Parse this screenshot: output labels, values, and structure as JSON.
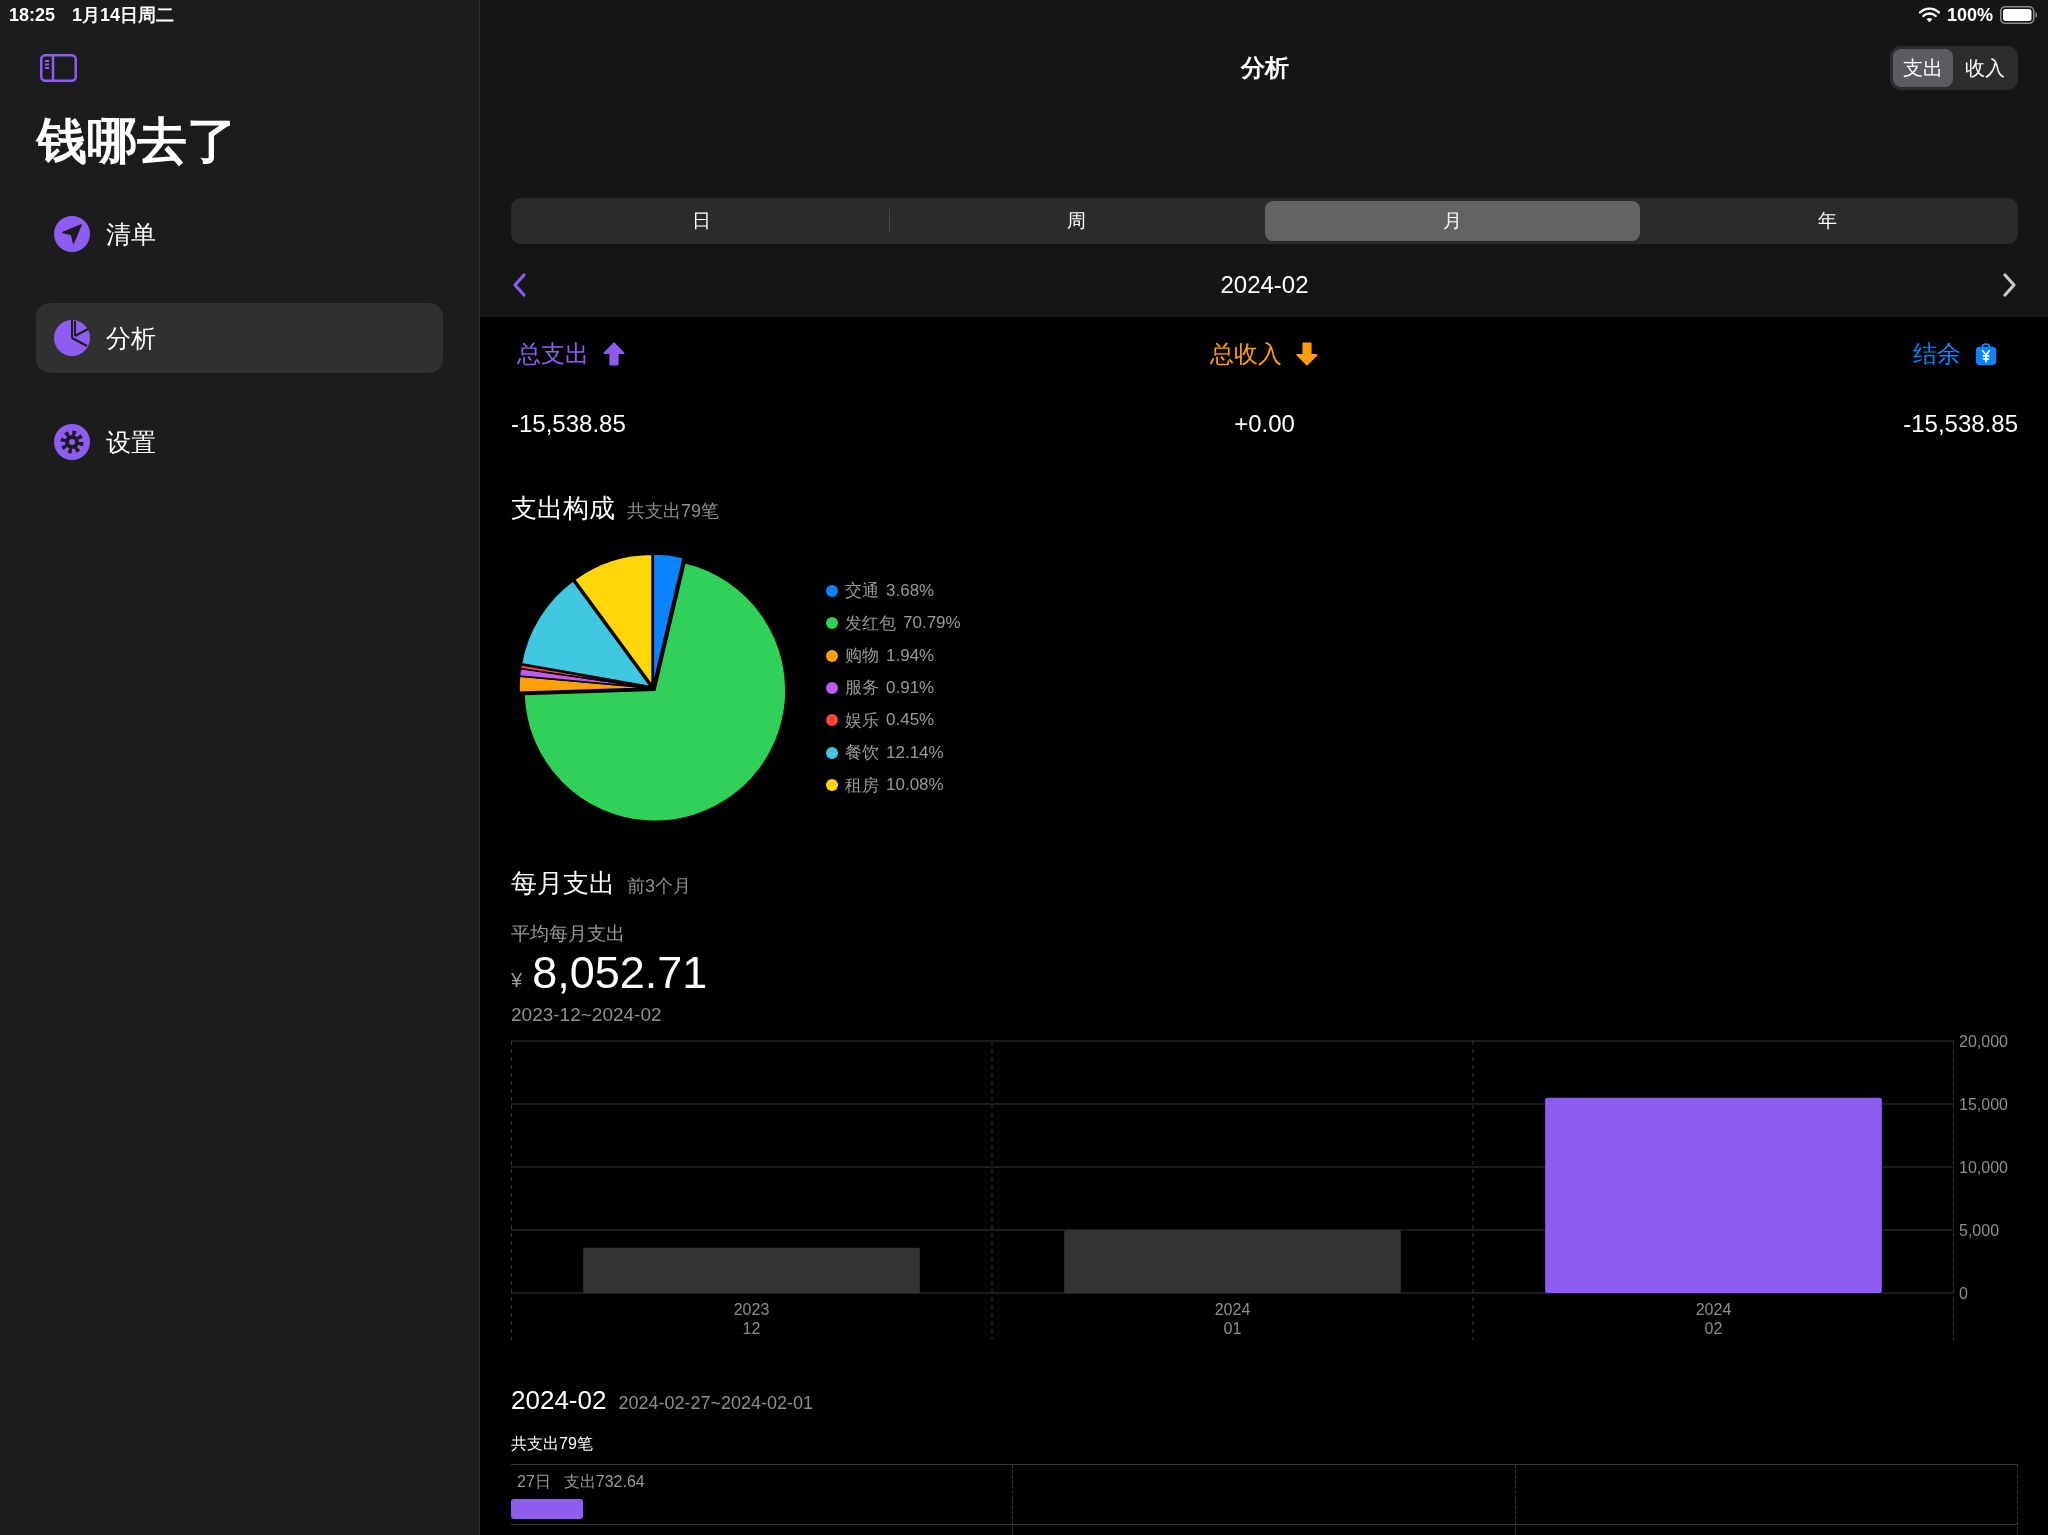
{
  "status_bar": {
    "time": "18:25",
    "date": "1月14日周二",
    "battery": "100%"
  },
  "sidebar": {
    "title": "钱哪去了",
    "items": [
      {
        "label": "清单",
        "selected": false
      },
      {
        "label": "分析",
        "selected": true
      },
      {
        "label": "设置",
        "selected": false
      }
    ]
  },
  "header": {
    "title": "分析",
    "type_toggle": [
      {
        "label": "支出",
        "selected": true
      },
      {
        "label": "收入",
        "selected": false
      }
    ],
    "periods": [
      {
        "label": "日",
        "selected": false
      },
      {
        "label": "周",
        "selected": false
      },
      {
        "label": "月",
        "selected": true
      },
      {
        "label": "年",
        "selected": false
      }
    ],
    "current_period": "2024-02"
  },
  "summary": [
    {
      "label": "总支出",
      "value": "-15,538.85",
      "color": "#8e5cf0"
    },
    {
      "label": "总收入",
      "value": "+0.00",
      "color": "#ff9f0a"
    },
    {
      "label": "结余",
      "value": "-15,538.85",
      "color": "#0a84ff"
    }
  ],
  "composition": {
    "title": "支出构成",
    "subtitle": "共支出79笔",
    "chart_data": {
      "type": "pie",
      "categories": [
        "交通",
        "发红包",
        "购物",
        "服务",
        "娱乐",
        "餐饮",
        "租房"
      ],
      "values": [
        3.68,
        70.79,
        1.94,
        0.91,
        0.45,
        12.14,
        10.08
      ]
    },
    "legend": [
      {
        "percent": "3.68%",
        "color": "#0a84ff"
      },
      {
        "percent": "70.79%",
        "color": "#30d158"
      },
      {
        "percent": "1.94%",
        "color": "#ff9f0a"
      },
      {
        "percent": "0.91%",
        "color": "#bf5af2"
      },
      {
        "percent": "0.45%",
        "color": "#ff453a"
      },
      {
        "percent": "12.14%",
        "color": "#40c8e0"
      },
      {
        "percent": "10.08%",
        "color": "#ffd60a"
      }
    ]
  },
  "monthly": {
    "title": "每月支出",
    "subtitle": "前3个月",
    "average_label": "平均每月支出",
    "currency": "¥",
    "average": "8,052.71",
    "range": "2023-12~2024-02",
    "chart_data": {
      "type": "bar",
      "categories": [
        "2023\n12",
        "2024\n01",
        "2024\n02"
      ],
      "series": [
        {
          "color": "#333333",
          "values": [
            3600,
            5000,
            null
          ]
        },
        {
          "color": "#8e5cf0",
          "values": [
            null,
            null,
            15500
          ]
        }
      ],
      "stacked": true,
      "grid": true,
      "ylim": [
        0,
        20000
      ],
      "yticks": [
        {
          "value": 0,
          "label": "0"
        },
        {
          "value": 5000,
          "label": "5,000"
        },
        {
          "value": 10000,
          "label": "10,000"
        },
        {
          "value": 15000,
          "label": "15,000"
        },
        {
          "value": 20000,
          "label": "20,000"
        }
      ]
    }
  },
  "daily": {
    "title": "2024-02",
    "range": "2024-02-27~2024-02-01",
    "count": "共支出79笔",
    "rows": [
      {
        "day": "27日",
        "amount": "支出732.64",
        "level": 0.048
      }
    ]
  }
}
